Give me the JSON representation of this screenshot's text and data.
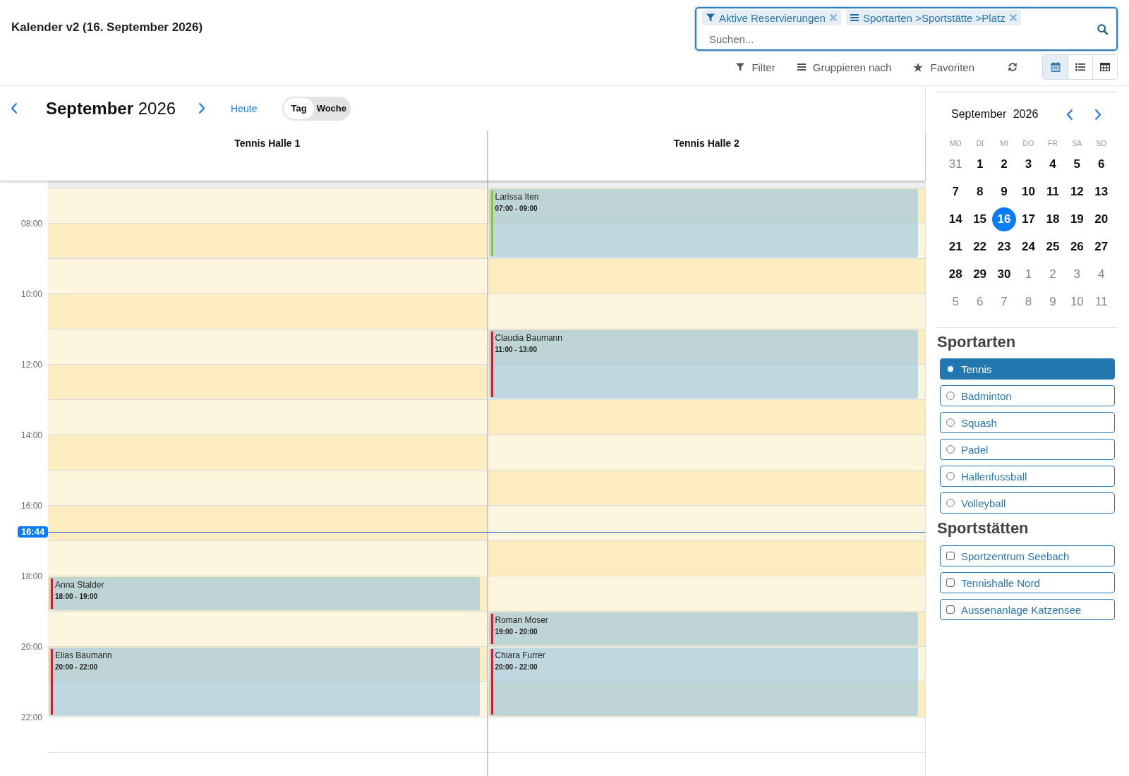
{
  "header": {
    "title": "Kalender v2 (16. September 2026)"
  },
  "search": {
    "facets": [
      {
        "kind": "filter",
        "label": "Aktive Reservierungen"
      },
      {
        "kind": "groupby",
        "label": "Sportarten >Sportstätte >Platz"
      }
    ],
    "placeholder": "Suchen..."
  },
  "toolbar": {
    "buttons": [
      {
        "kind": "filter",
        "label": "Filter"
      },
      {
        "kind": "groupby",
        "label": "Gruppieren nach"
      },
      {
        "kind": "favorites",
        "label": "Favoriten"
      }
    ],
    "views": [
      {
        "kind": "calendar",
        "selected": true
      },
      {
        "kind": "list",
        "selected": false
      },
      {
        "kind": "table",
        "selected": false
      }
    ]
  },
  "calendar": {
    "month": "September",
    "year": "2026",
    "today_label": "Heute",
    "scales": [
      {
        "label": "Tag",
        "selected": true
      },
      {
        "label": "Woche",
        "selected": false
      }
    ],
    "now": "16:44",
    "rows": [
      {
        "open": true
      },
      {
        "label": "08:00",
        "open": true
      },
      {
        "open": true
      },
      {
        "label": "10:00",
        "open": true
      },
      {
        "open": true
      },
      {
        "label": "12:00",
        "open": true
      },
      {
        "open": true
      },
      {
        "label": "14:00",
        "open": true
      },
      {
        "open": true
      },
      {
        "label": "16:00",
        "open": true
      },
      {
        "open": true
      },
      {
        "label": "18:00",
        "open": true
      },
      {
        "open": true
      },
      {
        "label": "20:00",
        "open": true
      },
      {
        "open": true
      },
      {
        "label": "22:00",
        "open": false
      }
    ],
    "columns": [
      {
        "title": "Tennis Halle 1",
        "events": [
          {
            "name": "Anna Stalder",
            "time": "18:00 - 19:00",
            "color": "#c8232c"
          },
          {
            "name": "Elias Baumann",
            "time": "20:00 - 22:00",
            "color": "#c8232c"
          }
        ]
      },
      {
        "title": "Tennis Halle 2",
        "events": [
          {
            "name": "Larissa Iten",
            "time": "07:00 - 09:00",
            "color": "#8bc34a"
          },
          {
            "name": "Claudia Baumann",
            "time": "11:00 - 13:00",
            "color": "#c8232c"
          },
          {
            "name": "Roman Moser",
            "time": "19:00 - 20:00",
            "color": "#c8232c"
          },
          {
            "name": "Chiara Furrer",
            "time": "20:00 - 22:00",
            "color": "#c8232c"
          }
        ]
      }
    ]
  },
  "mini_calendar": {
    "month": "September",
    "year": "2026",
    "weekdays": [
      "MO",
      "DI",
      "MI",
      "DO",
      "FR",
      "SA",
      "SO"
    ],
    "weeks": [
      {
        "days": [
          {
            "day": "31",
            "outside": true,
            "selected": false
          },
          {
            "day": "1",
            "outside": false,
            "selected": false
          },
          {
            "day": "2",
            "outside": false,
            "selected": false
          },
          {
            "day": "3",
            "outside": false,
            "selected": false
          },
          {
            "day": "4",
            "outside": false,
            "selected": false
          },
          {
            "day": "5",
            "outside": false,
            "selected": false
          },
          {
            "day": "6",
            "outside": false,
            "selected": false
          }
        ]
      },
      {
        "days": [
          {
            "day": "7",
            "outside": false,
            "selected": false
          },
          {
            "day": "8",
            "outside": false,
            "selected": false
          },
          {
            "day": "9",
            "outside": false,
            "selected": false
          },
          {
            "day": "10",
            "outside": false,
            "selected": false
          },
          {
            "day": "11",
            "outside": false,
            "selected": false
          },
          {
            "day": "12",
            "outside": false,
            "selected": false
          },
          {
            "day": "13",
            "outside": false,
            "selected": false
          }
        ]
      },
      {
        "days": [
          {
            "day": "14",
            "outside": false,
            "selected": false
          },
          {
            "day": "15",
            "outside": false,
            "selected": false
          },
          {
            "day": "16",
            "outside": false,
            "selected": true
          },
          {
            "day": "17",
            "outside": false,
            "selected": false
          },
          {
            "day": "18",
            "outside": false,
            "selected": false
          },
          {
            "day": "19",
            "outside": false,
            "selected": false
          },
          {
            "day": "20",
            "outside": false,
            "selected": false
          }
        ]
      },
      {
        "days": [
          {
            "day": "21",
            "outside": false,
            "selected": false
          },
          {
            "day": "22",
            "outside": false,
            "selected": false
          },
          {
            "day": "23",
            "outside": false,
            "selected": false
          },
          {
            "day": "24",
            "outside": false,
            "selected": false
          },
          {
            "day": "25",
            "outside": false,
            "selected": false
          },
          {
            "day": "26",
            "outside": false,
            "selected": false
          },
          {
            "day": "27",
            "outside": false,
            "selected": false
          }
        ]
      },
      {
        "days": [
          {
            "day": "28",
            "outside": false,
            "selected": false
          },
          {
            "day": "29",
            "outside": false,
            "selected": false
          },
          {
            "day": "30",
            "outside": false,
            "selected": false
          },
          {
            "day": "1",
            "outside": true,
            "selected": false
          },
          {
            "day": "2",
            "outside": true,
            "selected": false
          },
          {
            "day": "3",
            "outside": true,
            "selected": false
          },
          {
            "day": "4",
            "outside": true,
            "selected": false
          }
        ]
      },
      {
        "days": [
          {
            "day": "5",
            "outside": true,
            "selected": false
          },
          {
            "day": "6",
            "outside": true,
            "selected": false
          },
          {
            "day": "7",
            "outside": true,
            "selected": false
          },
          {
            "day": "8",
            "outside": true,
            "selected": false
          },
          {
            "day": "9",
            "outside": true,
            "selected": false
          },
          {
            "day": "10",
            "outside": true,
            "selected": false
          },
          {
            "day": "11",
            "outside": true,
            "selected": false
          }
        ]
      }
    ]
  },
  "sports": {
    "title": "Sportarten",
    "items": [
      {
        "label": "Tennis",
        "selected": true
      },
      {
        "label": "Badminton",
        "selected": false
      },
      {
        "label": "Squash",
        "selected": false
      },
      {
        "label": "Padel",
        "selected": false
      },
      {
        "label": "Hallenfussball",
        "selected": false
      },
      {
        "label": "Volleyball",
        "selected": false
      }
    ]
  },
  "venues": {
    "title": "Sportstätten",
    "items": [
      {
        "label": "Sportzentrum Seebach",
        "checked": false
      },
      {
        "label": "Tennishalle Nord",
        "checked": false
      },
      {
        "label": "Aussenanlage Katzensee",
        "checked": false
      }
    ]
  }
}
